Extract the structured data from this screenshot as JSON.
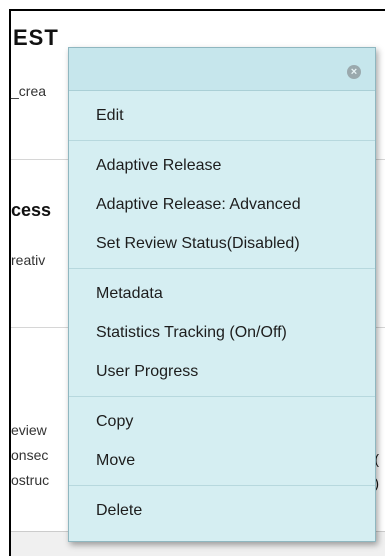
{
  "background": {
    "title": "EST",
    "row1_text": "_crea",
    "row2_heading": "cess",
    "row2_text": "reativ",
    "row3_line1": "eview",
    "row3_line2": "onsec",
    "row3_line3": "ostruc"
  },
  "menu": {
    "close_icon": "close-icon",
    "groups": [
      {
        "items": [
          {
            "label": "Edit"
          }
        ]
      },
      {
        "items": [
          {
            "label": "Adaptive Release"
          },
          {
            "label": "Adaptive Release: Advanced"
          },
          {
            "label": "Set Review Status(Disabled)"
          }
        ]
      },
      {
        "items": [
          {
            "label": "Metadata"
          },
          {
            "label": "Statistics Tracking (On/Off)"
          },
          {
            "label": "User Progress"
          }
        ]
      },
      {
        "items": [
          {
            "label": "Copy"
          },
          {
            "label": "Move"
          }
        ]
      },
      {
        "items": [
          {
            "label": "Delete"
          }
        ]
      }
    ]
  },
  "colors": {
    "menu_background": "#d5eef2",
    "menu_header": "#c6e6ec",
    "menu_border": "#8fb7c0"
  }
}
